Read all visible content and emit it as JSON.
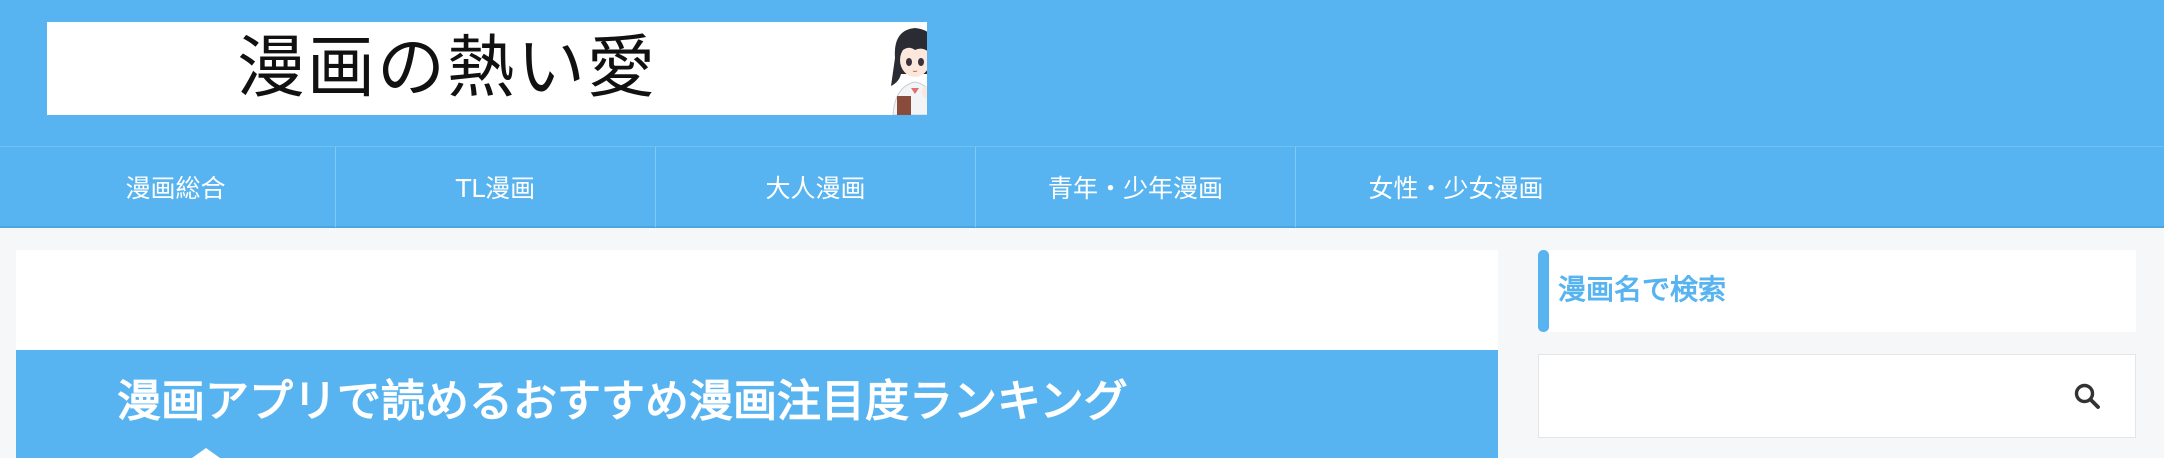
{
  "header": {
    "logo_text": "漫画の熱い愛",
    "background_color": "#58b4f0"
  },
  "nav": {
    "items": [
      {
        "label": "漫画総合"
      },
      {
        "label": "TL漫画"
      },
      {
        "label": "大人漫画"
      },
      {
        "label": "青年・少年漫画"
      },
      {
        "label": "女性・少女漫画"
      }
    ]
  },
  "main": {
    "article_title": "漫画アプリで読めるおすすめ漫画注目度ランキング"
  },
  "sidebar": {
    "search_heading": "漫画名で検索",
    "search_input_value": "",
    "search_icon": "search-icon",
    "accent_color": "#58b4f0"
  }
}
